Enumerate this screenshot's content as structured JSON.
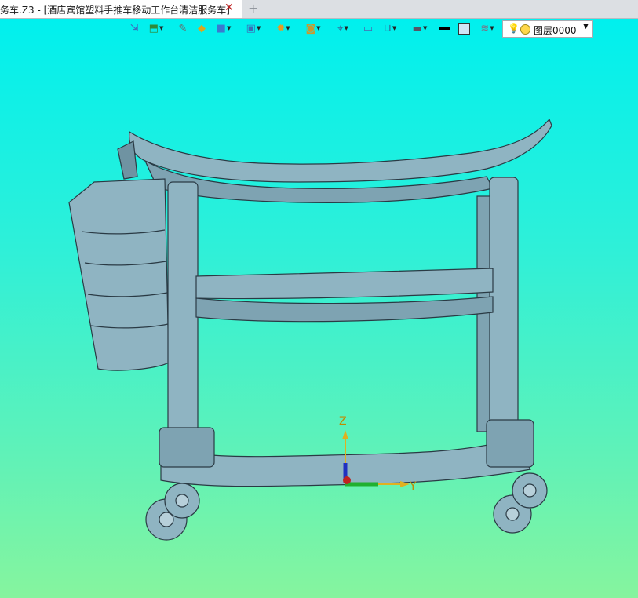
{
  "tab": {
    "title": "务车.Z3 - [酒店宾馆塑料手推车移动工作台清洁服务车]",
    "close_glyph": "✕",
    "add_glyph": "+"
  },
  "toolbar": {
    "icons": [
      "import-icon",
      "sketch-icon",
      "pen-icon",
      "box-icon",
      "cube-icon",
      "view-cube-icon",
      "render-sphere-icon",
      "shade-icon",
      "snap-icon",
      "window-icon",
      "dimension-icon",
      "display-icon",
      "line-color-swatch",
      "fill-swatch",
      "layers-icon"
    ]
  },
  "layer": {
    "value": "图层0000",
    "arrow": "▼"
  },
  "axes": {
    "z_label": "Z",
    "y_label": "Y"
  },
  "colors": {
    "background_top": "#00f0ee",
    "background_bottom": "#86f49e",
    "model_fill": "#8fb4c2",
    "model_stroke": "#2a3a44"
  }
}
